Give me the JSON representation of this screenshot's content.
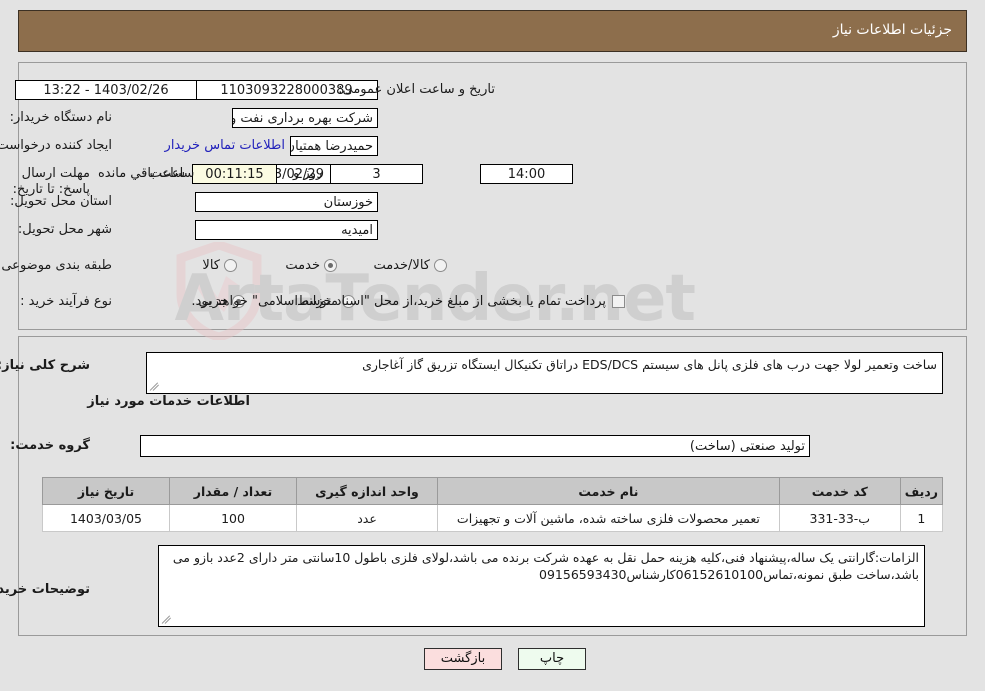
{
  "header": {
    "title": "جزئیات اطلاعات نیاز"
  },
  "fields": {
    "need_number_label": "شماره نیاز:",
    "need_number_value": "1103093228000389",
    "buyer_org_label": "نام دستگاه خریدار:",
    "buyer_org_value": "شرکت بهره برداری نفت و گاز اغاجاری",
    "requester_label": "ایجاد کننده درخواست:",
    "requester_value": "حمیدرضا همتیان برنامه ریز ارشد تعمیرات شرکت بهره برداری نفت و گاز اغاجاری",
    "deadline_label": "مهلت ارسال پاسخ: تا تاریخ:",
    "deadline_date": "1403/02/29",
    "province_label": "استان محل تحویل:",
    "province_value": "خوزستان",
    "city_label": "شهر محل تحویل:",
    "city_value": "امیدیه",
    "announce_label": "تاریخ و ساعت اعلان عمومی:",
    "announce_value": "1403/02/26 - 13:22",
    "hour_label": "ساعت",
    "hour_value": "14:00",
    "days_value": "3",
    "days_suffix": "روز و",
    "remaining_value": "00:11:15",
    "remaining_suffix": "ساعت باقي مانده",
    "contact_link": "اطلاعات تماس خریدار"
  },
  "classification": {
    "label": "طبقه بندی موضوعی:",
    "options": [
      {
        "label": "کالا",
        "selected": false
      },
      {
        "label": "خدمت",
        "selected": true
      },
      {
        "label": "کالا/خدمت",
        "selected": false
      }
    ]
  },
  "process_type": {
    "label": "نوع فرآیند خرید :",
    "options": [
      {
        "label": "جزیی",
        "selected": true
      },
      {
        "label": "متوسط",
        "selected": false
      }
    ],
    "treasury_note": "پرداخت تمام یا بخشی از مبلغ خرید،از محل \"اسناد خزانه اسلامی\" خواهد بود."
  },
  "description": {
    "label": "شرح کلی نیاز:",
    "value": "ساخت وتعمیر لولا جهت درب های فلزی پانل های سیستم EDS/DCS دراتاق تکنیکال ایستگاه تزریق گاز آغاجاری"
  },
  "services_section": {
    "title": "اطلاعات خدمات مورد نیاز",
    "group_label": "گروه خدمت:",
    "group_value": "تولید صنعتی (ساخت)"
  },
  "table": {
    "columns": [
      "ردیف",
      "کد خدمت",
      "نام خدمت",
      "واحد اندازه گیری",
      "تعداد / مقدار",
      "تاریخ نیاز"
    ],
    "rows": [
      {
        "row": "1",
        "code": "ب-33-331",
        "name": "تعمیر محصولات فلزی ساخته شده، ماشین آلات و تجهیزات",
        "unit": "عدد",
        "qty": "100",
        "date": "1403/03/05"
      }
    ]
  },
  "buyer_notes": {
    "label": "توضیحات خریدار:",
    "value": "الزامات:گارانتی یک ساله،پیشنهاد فنی،کلیه هزینه حمل نقل به عهده شرکت برنده می باشد،لولای فلزی باطول 10سانتی متر دارای 2عدد بازو می باشد،ساخت طبق نمونه،تماس06152610100کارشناس09156593430"
  },
  "footer": {
    "print_label": "چاپ",
    "back_label": "بازگشت"
  },
  "watermark": {
    "text": "ArtaTender.net"
  },
  "colors": {
    "header_bg": "#8d6e4c",
    "page_bg": "#e3e3e3",
    "link": "#2222bb",
    "table_header_bg": "#c8c8c8",
    "highlight_field": "#fbfbe2",
    "print_btn": "#eefbee",
    "back_btn": "#fbdede"
  }
}
